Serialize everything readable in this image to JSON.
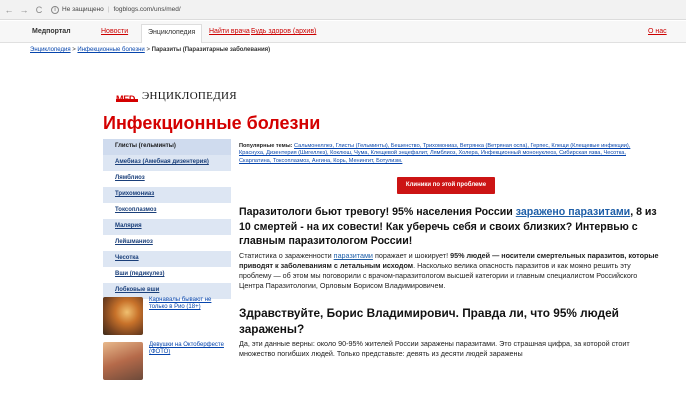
{
  "browser": {
    "back_icon": "arrow-left",
    "forward_icon": "arrow-right",
    "reload_icon": "reload",
    "security_label": "Не защищено",
    "url": "fogblogs.com/uns/med/"
  },
  "nav": {
    "brand": "Медпортал",
    "items": [
      {
        "label": "Новости"
      },
      {
        "label": "Энциклопедия"
      },
      {
        "label": "Найти врача"
      },
      {
        "label": "Будь здоров (архив)"
      }
    ],
    "about": "О нас"
  },
  "breadcrumb": {
    "part1": "Энциклопедия",
    "sep1": " > ",
    "part2": "Инфекционные болезни",
    "sep2": " > ",
    "current": "Паразиты (Паразитарные заболевания)"
  },
  "logo": {
    "mark": "MED",
    "word": "ЭНЦИКЛОПЕДИЯ"
  },
  "page_title": "Инфекционные болезни",
  "sidebar": {
    "items": [
      {
        "label": "Глисты (гельминты)"
      },
      {
        "label": "Амебиаз (Амебная дизентерия)"
      },
      {
        "label": "Лямблиоз"
      },
      {
        "label": "Трихомониаз"
      },
      {
        "label": "Токсоплазмоз"
      },
      {
        "label": "Малярия"
      },
      {
        "label": "Лейшманиоз"
      },
      {
        "label": "Чесотка"
      },
      {
        "label": "Вши (педикулез)"
      },
      {
        "label": "Лобковые вши"
      }
    ],
    "promos": [
      {
        "text": "Карнавалы бывают не только в Рио (18+)"
      },
      {
        "text": "Девушки на Октоберфесте (ФОТО)"
      }
    ]
  },
  "popular": {
    "label": "Популярные темы:",
    "links": "Сальмонеллез, Глисты (Гельминты), Бешенство, Трихомониаз, Ветрянка (Ветряная оспа), Герпес, Клещи (Клещевые инфекции), Краснуха, Дизентерия (Шигеллез), Коклюш, Чума, Клещевой энцефалит, Лямблиоз, Холера, Инфекционный мононуклеоз, Сибирская язва, Чесотка, Скарлатина, Токсоплазмоз, Ангина, Корь, Менингит, Ботулизм."
  },
  "cta_button": "Клиники по этой проблеме",
  "article": {
    "headline_a": "Паразитологи бьют тревогу! 95% населения России ",
    "headline_link": "заражено паразитами",
    "headline_b": ", 8 из 10 смертей - на их совести! Как уберечь себя и своих близких? Интервью с главным паразитологом России!",
    "p1_a": "Статистика о зараженности ",
    "p1_link": "паразитами",
    "p1_b": " поражает и шокирует! ",
    "p1_bold": "95% людей — носители смертельных паразитов, которые приводят к заболеваниям с летальным исходом",
    "p1_c": ". Насколько велика опасность паразитов и как можно решить эту проблему — об этом мы поговорили с врачом-паразитологом высшей категории и главным специалистом Российского Центра Паразитологии, Орловым Борисом Владимировичем.",
    "h2": "Здравствуйте, Борис Владимирович. Правда ли, что 95% людей заражены?",
    "p2": "Да, эти данные верны: около 90-95% жителей России заражены паразитами. Это страшная цифра, за которой стоит множество погибших людей. Только представьте: девять из десяти людей заражены"
  }
}
